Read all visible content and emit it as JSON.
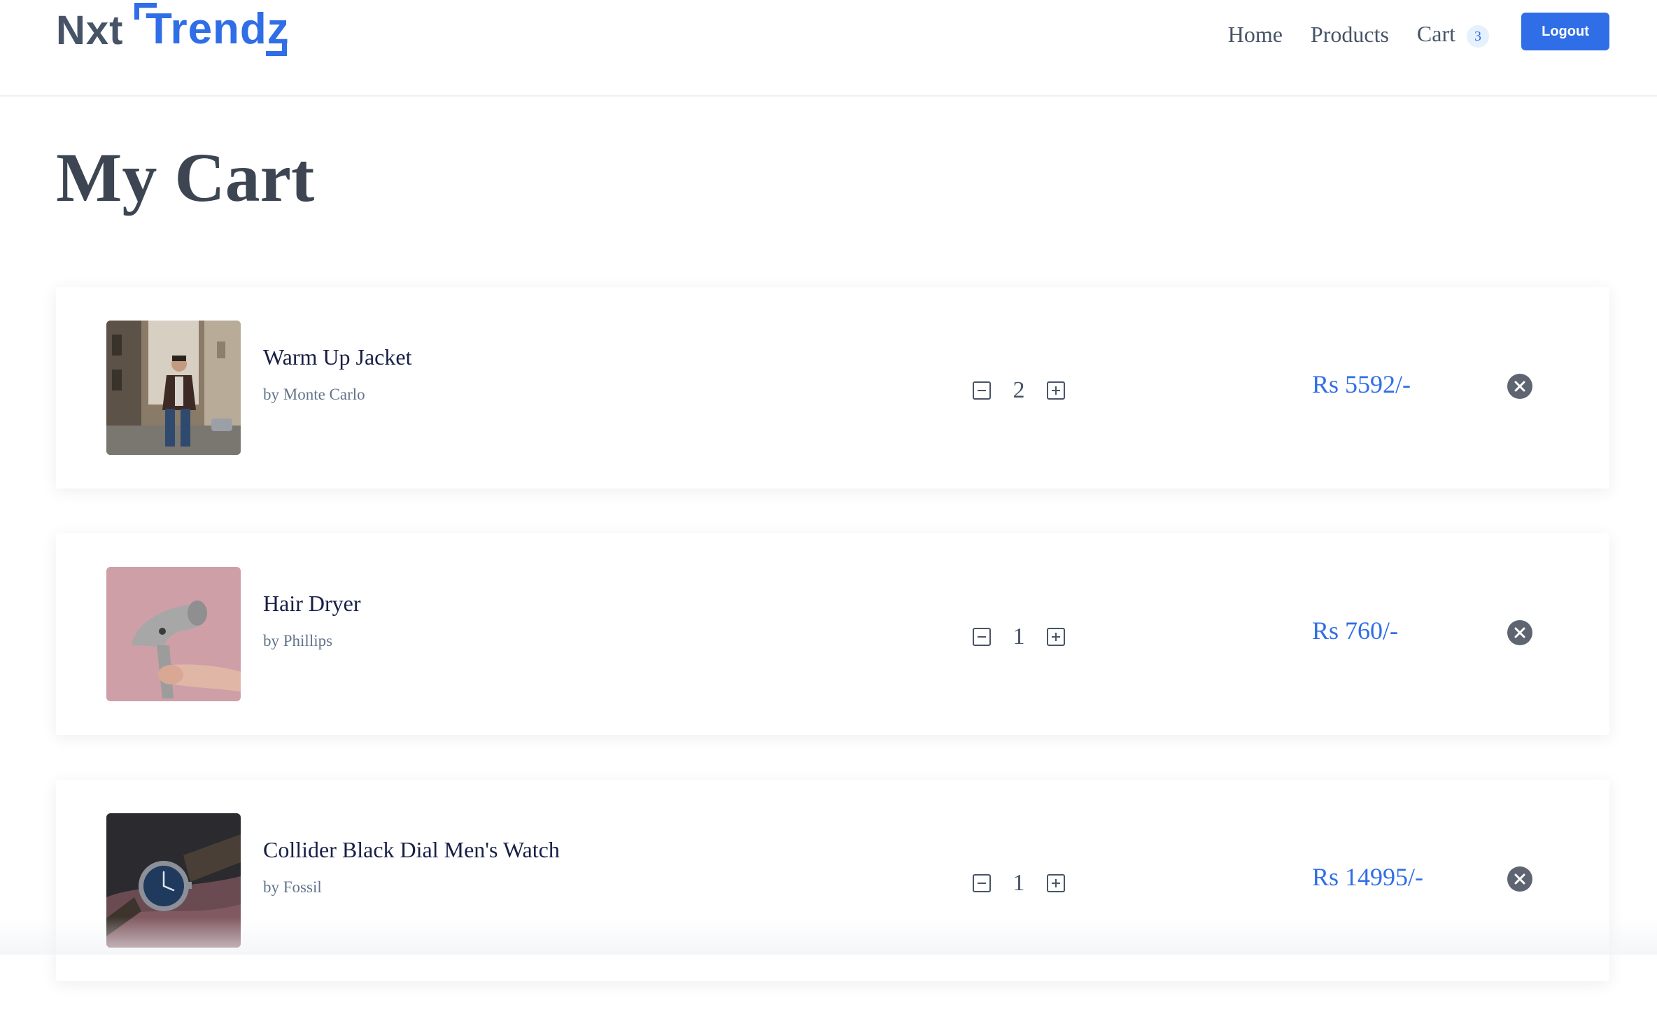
{
  "header": {
    "logo": {
      "part1": "Nxt",
      "part2": "Trendz"
    },
    "nav": {
      "home": "Home",
      "products": "Products",
      "cart": "Cart",
      "cart_count": "3"
    },
    "logout_label": "Logout"
  },
  "main": {
    "title": "My Cart",
    "items": [
      {
        "title": "Warm Up Jacket",
        "brand": "by Monte Carlo",
        "quantity": "2",
        "price": "Rs 5592/-",
        "image": "jacket-photo"
      },
      {
        "title": "Hair Dryer",
        "brand": "by Phillips",
        "quantity": "1",
        "price": "Rs 760/-",
        "image": "hair-dryer-photo"
      },
      {
        "title": "Collider Black Dial Men's Watch",
        "brand": "by Fossil",
        "quantity": "1",
        "price": "Rs 14995/-",
        "image": "watch-photo"
      }
    ]
  },
  "colors": {
    "accent": "#2f6ee6",
    "heading": "#3d4552",
    "text": "#475467",
    "muted": "#64748b",
    "remove_icon_bg": "#5e6470"
  },
  "icons": {
    "decrease": "minus-square-icon",
    "increase": "plus-square-icon",
    "remove": "close-circle-icon"
  }
}
